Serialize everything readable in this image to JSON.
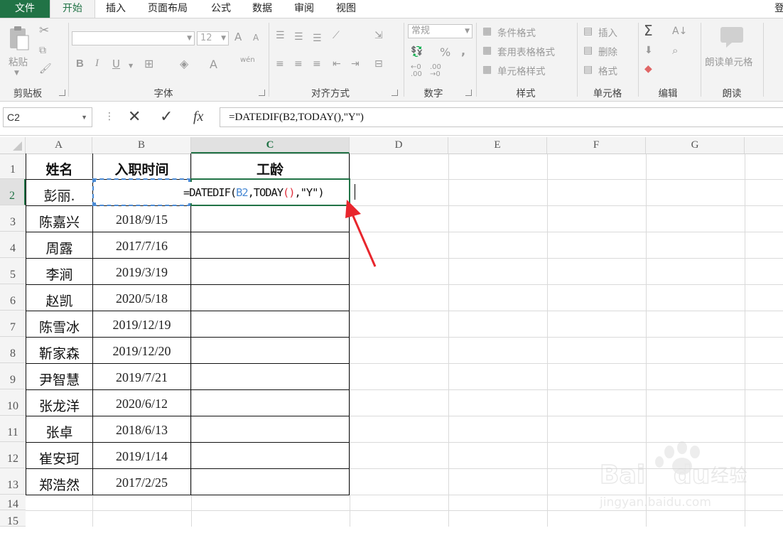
{
  "tabs": [
    {
      "label": "文件",
      "name": "tab-file"
    },
    {
      "label": "开始",
      "name": "tab-home"
    },
    {
      "label": "插入",
      "name": "tab-insert"
    },
    {
      "label": "页面布局",
      "name": "tab-page-layout"
    },
    {
      "label": "公式",
      "name": "tab-formulas"
    },
    {
      "label": "数据",
      "name": "tab-data"
    },
    {
      "label": "审阅",
      "name": "tab-review"
    },
    {
      "label": "视图",
      "name": "tab-view"
    }
  ],
  "account_label": "登",
  "ribbon": {
    "clipboard": {
      "paste": "粘贴",
      "label": "剪贴板"
    },
    "font": {
      "size": "12",
      "label": "字体",
      "bold": "B",
      "italic": "I",
      "underline": "U",
      "grow": "A",
      "shrink": "A",
      "font_color": "A",
      "phonetic": "wén"
    },
    "alignment": {
      "label": "对齐方式"
    },
    "number": {
      "format": "常规",
      "label": "数字",
      "percent": "%",
      "comma": ","
    },
    "styles": {
      "conditional": "条件格式",
      "table": "套用表格格式",
      "cell_styles": "单元格样式",
      "label": "样式"
    },
    "cells": {
      "insert": "插入",
      "delete": "删除",
      "format": "格式",
      "label": "单元格"
    },
    "editing": {
      "label": "编辑",
      "sum": "Σ"
    },
    "read": {
      "button": "朗读单元格",
      "label": "朗读"
    }
  },
  "formula_bar": {
    "name_box": "C2",
    "fx": "fx",
    "formula": "=DATEDIF(B2,TODAY(),\"Y\")"
  },
  "columns": [
    "A",
    "B",
    "C",
    "D",
    "E",
    "F",
    "G"
  ],
  "rows": [
    "1",
    "2",
    "3",
    "4",
    "5",
    "6",
    "7",
    "8",
    "9",
    "10",
    "11",
    "12",
    "13",
    "14",
    "15"
  ],
  "table": {
    "headers": [
      "姓名",
      "入职时间",
      "工龄"
    ],
    "records": [
      {
        "name": "彭丽.",
        "date": ""
      },
      {
        "name": "陈嘉兴",
        "date": "2018/9/15"
      },
      {
        "name": "周露",
        "date": "2017/7/16"
      },
      {
        "name": "李涧",
        "date": "2019/3/19"
      },
      {
        "name": "赵凯",
        "date": "2020/5/18"
      },
      {
        "name": "陈雪冰",
        "date": "2019/12/19"
      },
      {
        "name": "靳家森",
        "date": "2019/12/20"
      },
      {
        "name": "尹智慧",
        "date": "2019/7/21"
      },
      {
        "name": "张龙洋",
        "date": "2020/6/12"
      },
      {
        "name": "张卓",
        "date": "2018/6/13"
      },
      {
        "name": "崔安珂",
        "date": "2019/1/14"
      },
      {
        "name": "郑浩然",
        "date": "2017/2/25"
      }
    ]
  },
  "cell_edit": {
    "eq": "=DATEDIF(",
    "ref": "B2",
    "mid": ",TODAY",
    "paren": "()",
    "tail": ",\"Y\")"
  },
  "watermark": "Baidu经验 jingyan.baidu.com",
  "colors": {
    "excel_green": "#217346",
    "ref_blue": "#4a8ad4",
    "paren_red": "#e0313e",
    "arrow_red": "#e8262d"
  }
}
